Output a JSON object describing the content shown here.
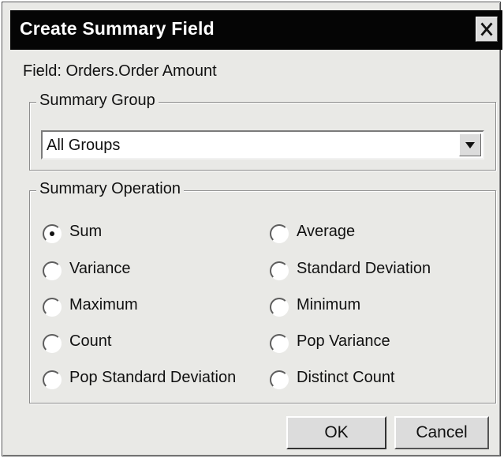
{
  "window": {
    "title": "Create Summary Field",
    "close_icon": "close-icon"
  },
  "field": {
    "label": "Field: Orders.Order Amount"
  },
  "summary_group": {
    "legend": "Summary Group",
    "selected": "All Groups",
    "dropdown_icon": "chevron-down-icon"
  },
  "summary_operation": {
    "legend": "Summary Operation",
    "options": [
      {
        "label": "Sum",
        "selected": true
      },
      {
        "label": "Average",
        "selected": false
      },
      {
        "label": "Variance",
        "selected": false
      },
      {
        "label": "Standard Deviation",
        "selected": false
      },
      {
        "label": "Maximum",
        "selected": false
      },
      {
        "label": "Minimum",
        "selected": false
      },
      {
        "label": "Count",
        "selected": false
      },
      {
        "label": "Pop Variance",
        "selected": false
      },
      {
        "label": "Pop Standard Deviation",
        "selected": false
      },
      {
        "label": "Distinct Count",
        "selected": false
      }
    ]
  },
  "buttons": {
    "ok": "OK",
    "cancel": "Cancel"
  },
  "colors": {
    "title_bar": "#050505",
    "dialog_background": "#e9e9e6",
    "text": "#111111"
  }
}
